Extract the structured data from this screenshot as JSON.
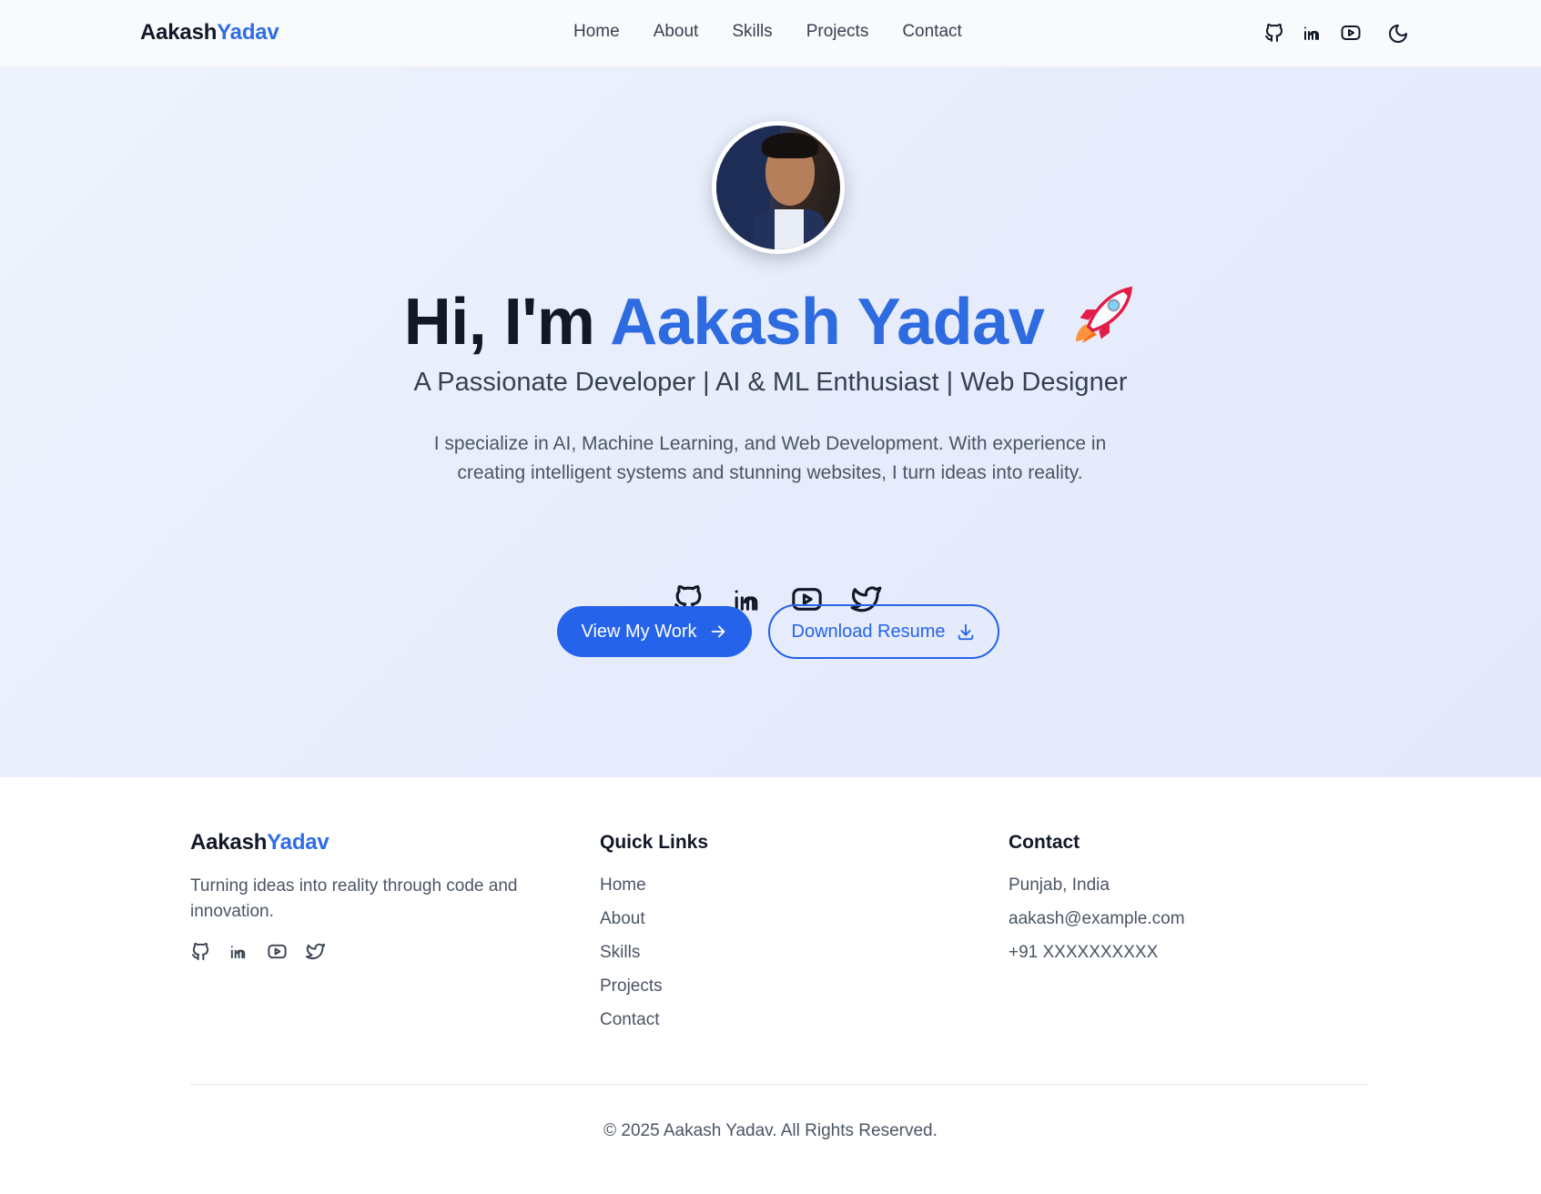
{
  "brand": {
    "first": "Aakash",
    "second": "Yadav"
  },
  "colors": {
    "accent": "#2563eb",
    "heading": "#111827",
    "hero_bg": "#e8eefc"
  },
  "nav": {
    "links": [
      "Home",
      "About",
      "Skills",
      "Projects",
      "Contact"
    ],
    "icons": [
      "github-icon",
      "linkedin-icon",
      "youtube-icon"
    ],
    "theme_icon": "moon-icon"
  },
  "hero": {
    "greeting": "Hi, I'm ",
    "name": "Aakash Yadav",
    "emoji_icon": "rocket-icon",
    "subtitle": "A Passionate Developer | AI & ML Enthusiast | Web Designer",
    "description": "I specialize in AI, Machine Learning, and Web Development. With experience in creating intelligent systems and stunning websites, I turn ideas into reality.",
    "social_icons": [
      "github-icon",
      "linkedin-icon",
      "youtube-icon",
      "twitter-icon"
    ],
    "primary_button": "View My Work",
    "secondary_button": "Download Resume"
  },
  "footer": {
    "tagline": "Turning ideas into reality through code and innovation.",
    "social_icons": [
      "github-icon",
      "linkedin-icon",
      "youtube-icon",
      "twitter-icon"
    ],
    "quick_links_heading": "Quick Links",
    "quick_links": [
      "Home",
      "About",
      "Skills",
      "Projects",
      "Contact"
    ],
    "contact_heading": "Contact",
    "contact": {
      "location": "Punjab, India",
      "email": "aakash@example.com",
      "phone": "+91 XXXXXXXXXX"
    },
    "copyright": "© 2025 Aakash Yadav. All Rights Reserved."
  }
}
